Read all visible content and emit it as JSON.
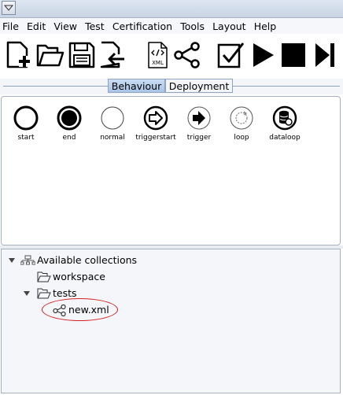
{
  "menu": {
    "items": [
      "File",
      "Edit",
      "View",
      "Test",
      "Certification",
      "Tools",
      "Layout",
      "Help"
    ]
  },
  "toolbar": {
    "buttons": [
      {
        "name": "new-file-icon"
      },
      {
        "name": "open-folder-icon"
      },
      {
        "name": "save-icon"
      },
      {
        "name": "export-icon"
      },
      {
        "name": "xml-icon",
        "badge": "XML"
      },
      {
        "name": "share-nodes-icon"
      },
      {
        "name": "check-icon"
      },
      {
        "name": "play-icon"
      },
      {
        "name": "stop-icon"
      },
      {
        "name": "step-forward-icon"
      }
    ]
  },
  "tabs": [
    {
      "label": "Behaviour",
      "active": true
    },
    {
      "label": "Deployment",
      "active": false
    }
  ],
  "palette": {
    "items": [
      {
        "label": "start",
        "icon": "start-node-icon"
      },
      {
        "label": "end",
        "icon": "end-node-icon"
      },
      {
        "label": "normal",
        "icon": "normal-node-icon"
      },
      {
        "label": "triggerstart",
        "icon": "triggerstart-node-icon"
      },
      {
        "label": "trigger",
        "icon": "trigger-node-icon"
      },
      {
        "label": "loop",
        "icon": "loop-node-icon"
      },
      {
        "label": "dataloop",
        "icon": "dataloop-node-icon"
      }
    ]
  },
  "tree": {
    "root": "Available collections",
    "workspace": "workspace",
    "tests": "tests",
    "file": "new.xml"
  },
  "colors": {
    "tab_active": "#b8d0ee",
    "annotation": "#d42020"
  }
}
